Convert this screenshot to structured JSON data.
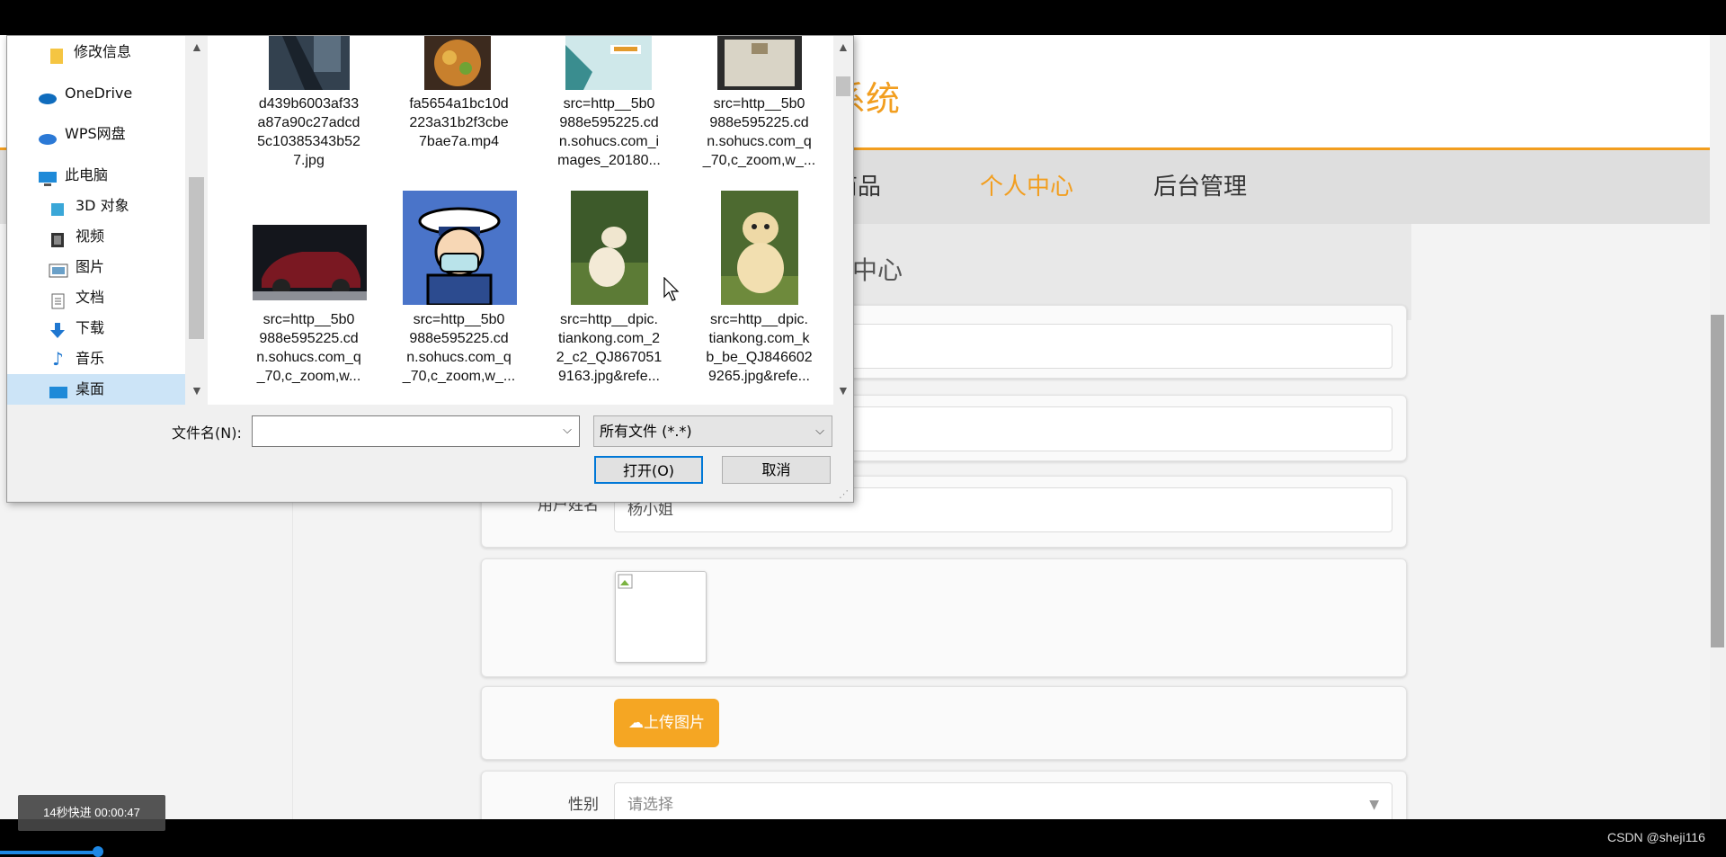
{
  "site": {
    "title_fragment": "系统",
    "nav": [
      "商品",
      "个人中心",
      "后台管理"
    ],
    "active_nav": "个人中心",
    "section_title": "中心",
    "accent": "#f29e1f"
  },
  "form": {
    "name_label": "用户姓名",
    "name_value": "杨小姐",
    "upload_label": "上传图片",
    "gender_label": "性别",
    "gender_placeholder": "请选择"
  },
  "dialog": {
    "sidebar": [
      {
        "label": "修改信息",
        "icon": "folder-icon"
      },
      {
        "label": "OneDrive",
        "icon": "cloud-icon"
      },
      {
        "label": "WPS网盘",
        "icon": "cloud-icon"
      },
      {
        "label": "此电脑",
        "icon": "computer-icon"
      },
      {
        "label": "3D 对象",
        "icon": "cube-icon"
      },
      {
        "label": "视频",
        "icon": "video-icon"
      },
      {
        "label": "图片",
        "icon": "picture-icon"
      },
      {
        "label": "文档",
        "icon": "document-icon"
      },
      {
        "label": "下载",
        "icon": "download-icon"
      },
      {
        "label": "音乐",
        "icon": "music-icon"
      },
      {
        "label": "桌面",
        "icon": "desktop-icon"
      }
    ],
    "files": [
      {
        "lines": [
          "d439b6003af33",
          "a87a90c27adcd",
          "5c10385343b52",
          "7.jpg"
        ]
      },
      {
        "lines": [
          "fa5654a1bc10d",
          "223a31b2f3cbe",
          "7bae7a.mp4"
        ]
      },
      {
        "lines": [
          "src=http__5b0",
          "988e595225.cd",
          "n.sohucs.com_i",
          "mages_20180..."
        ]
      },
      {
        "lines": [
          "src=http__5b0",
          "988e595225.cd",
          "n.sohucs.com_q",
          "_70,c_zoom,w_..."
        ]
      },
      {
        "lines": [
          "src=http__5b0",
          "988e595225.cd",
          "n.sohucs.com_q",
          "_70,c_zoom,w..."
        ]
      },
      {
        "lines": [
          "src=http__5b0",
          "988e595225.cd",
          "n.sohucs.com_q",
          "_70,c_zoom,w_..."
        ]
      },
      {
        "lines": [
          "src=http__dpic.",
          "tiankong.com_2",
          "2_c2_QJ867051",
          "9163.jpg&refe..."
        ]
      },
      {
        "lines": [
          "src=http__dpic.",
          "tiankong.com_k",
          "b_be_QJ846602",
          "9265.jpg&refe..."
        ]
      }
    ],
    "filename_label": "文件名(N):",
    "filename_value": "",
    "filetype_value": "所有文件 (*.*)",
    "open_label": "打开(O)",
    "cancel_label": "取消"
  },
  "video": {
    "toast": "14秒快进   00:00:47",
    "watermark": "CSDN @sheji116",
    "progress_percent": 5.7
  }
}
